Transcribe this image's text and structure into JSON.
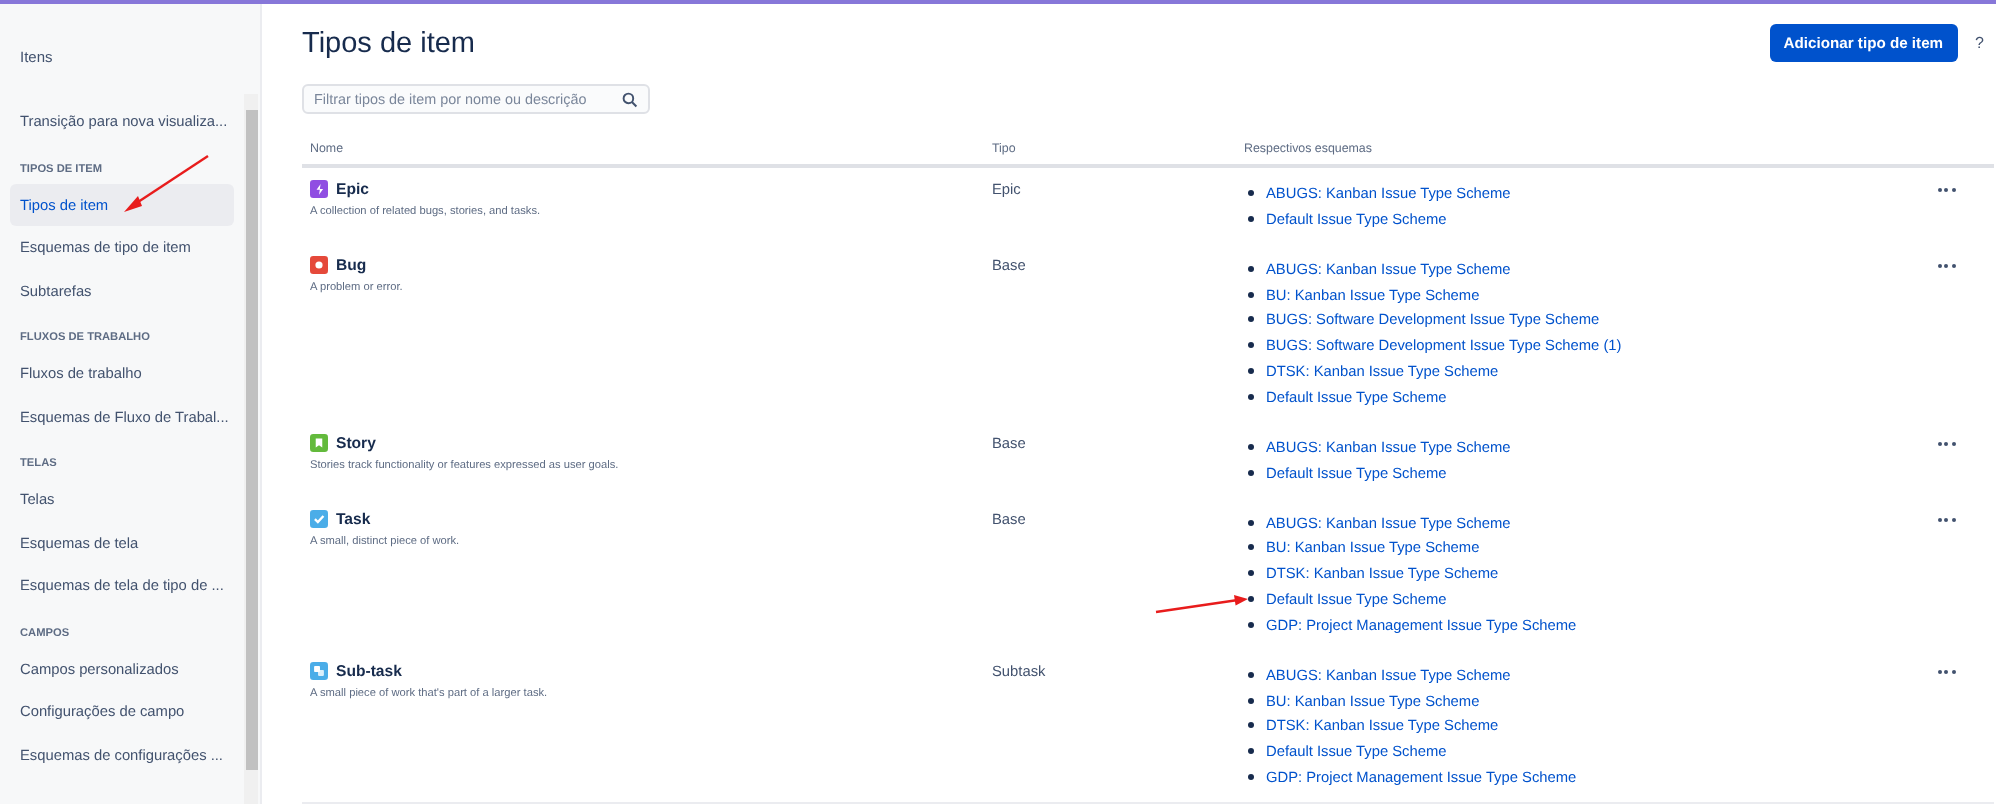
{
  "sidebar": {
    "title": "Itens",
    "groups": [
      {
        "items": [
          {
            "label": "Transição para nova visualiza...",
            "selected": false
          }
        ]
      },
      {
        "heading": "TIPOS DE ITEM",
        "items": [
          {
            "label": "Tipos de item",
            "selected": true
          },
          {
            "label": "Esquemas de tipo de item",
            "selected": false
          },
          {
            "label": "Subtarefas",
            "selected": false
          }
        ]
      },
      {
        "heading": "FLUXOS DE TRABALHO",
        "items": [
          {
            "label": "Fluxos de trabalho",
            "selected": false
          },
          {
            "label": "Esquemas de Fluxo de Trabal...",
            "selected": false
          }
        ]
      },
      {
        "heading": "TELAS",
        "items": [
          {
            "label": "Telas",
            "selected": false
          },
          {
            "label": "Esquemas de tela",
            "selected": false
          },
          {
            "label": "Esquemas de tela de tipo de ...",
            "selected": false
          }
        ]
      },
      {
        "heading": "CAMPOS",
        "items": [
          {
            "label": "Campos personalizados",
            "selected": false
          },
          {
            "label": "Configurações de campo",
            "selected": false
          },
          {
            "label": "Esquemas de configurações ...",
            "selected": false
          }
        ]
      }
    ]
  },
  "page": {
    "title": "Tipos de item",
    "add_button": "Adicionar tipo de item",
    "help": "?",
    "search": {
      "placeholder": "Filtrar tipos de item por nome ou descrição"
    }
  },
  "table": {
    "columns": [
      "Nome",
      "Tipo",
      "Respectivos esquemas"
    ],
    "rows": [
      {
        "kind": "epic",
        "color": "#904ee2",
        "name": "Epic",
        "description": "A collection of related bugs, stories, and tasks.",
        "type": "Epic",
        "schemes": [
          "ABUGS: Kanban Issue Type Scheme",
          "Default Issue Type Scheme"
        ]
      },
      {
        "kind": "bug",
        "color": "#e5493a",
        "name": "Bug",
        "description": "A problem or error.",
        "type": "Base",
        "schemes": [
          "ABUGS: Kanban Issue Type Scheme",
          "BU: Kanban Issue Type Scheme",
          "BUGS: Software Development Issue Type Scheme",
          "BUGS: Software Development Issue Type Scheme (1)",
          "DTSK: Kanban Issue Type Scheme",
          "Default Issue Type Scheme"
        ]
      },
      {
        "kind": "story",
        "color": "#63ba3c",
        "name": "Story",
        "description": "Stories track functionality or features expressed as user goals.",
        "type": "Base",
        "schemes": [
          "ABUGS: Kanban Issue Type Scheme",
          "Default Issue Type Scheme"
        ]
      },
      {
        "kind": "task",
        "color": "#4bade8",
        "name": "Task",
        "description": "A small, distinct piece of work.",
        "type": "Base",
        "schemes": [
          "ABUGS: Kanban Issue Type Scheme",
          "BU: Kanban Issue Type Scheme",
          "DTSK: Kanban Issue Type Scheme",
          "Default Issue Type Scheme",
          "GDP: Project Management Issue Type Scheme"
        ]
      },
      {
        "kind": "subtask",
        "color": "#4bade8",
        "name": "Sub-task",
        "description": "A small piece of work that's part of a larger task.",
        "type": "Subtask",
        "schemes": [
          "ABUGS: Kanban Issue Type Scheme",
          "BU: Kanban Issue Type Scheme",
          "DTSK: Kanban Issue Type Scheme",
          "Default Issue Type Scheme",
          "GDP: Project Management Issue Type Scheme"
        ]
      }
    ]
  }
}
